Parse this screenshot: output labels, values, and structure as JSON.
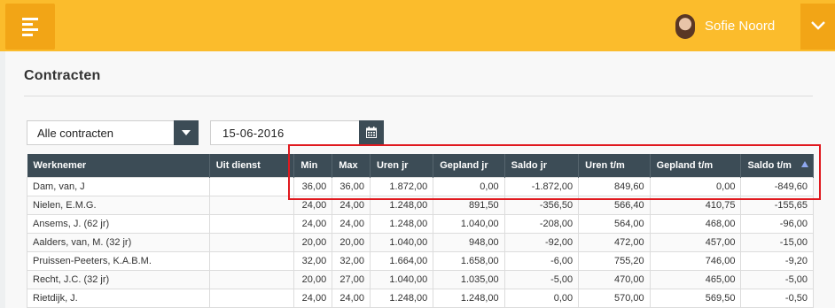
{
  "header": {
    "user_name": "Sofie Noord",
    "accent_color": "#fbbc2c",
    "accent_dark": "#f2a516",
    "menu_icon": "hamburger-menu-icon",
    "toggle_icon": "chevron-down-icon"
  },
  "page": {
    "title": "Contracten"
  },
  "filters": {
    "contract_select": "Alle contracten",
    "date": "15-06-2016",
    "date_icon": "calendar-icon",
    "select_icon": "caret-down-icon"
  },
  "table": {
    "headers": [
      "Werknemer",
      "Uit dienst",
      "Min",
      "Max",
      "Uren jr",
      "Gepland jr",
      "Saldo jr",
      "Uren t/m",
      "Gepland t/m",
      "Saldo t/m"
    ],
    "sort_column": "Saldo t/m",
    "sort_direction": "ascending",
    "rows": [
      [
        "Dam, van, J",
        "",
        "36,00",
        "36,00",
        "1.872,00",
        "0,00",
        "-1.872,00",
        "849,60",
        "0,00",
        "-849,60"
      ],
      [
        "Nielen, E.M.G.",
        "",
        "24,00",
        "24,00",
        "1.248,00",
        "891,50",
        "-356,50",
        "566,40",
        "410,75",
        "-155,65"
      ],
      [
        "Ansems, J. (62 jr)",
        "",
        "24,00",
        "24,00",
        "1.248,00",
        "1.040,00",
        "-208,00",
        "564,00",
        "468,00",
        "-96,00"
      ],
      [
        "Aalders, van, M. (32 jr)",
        "",
        "20,00",
        "20,00",
        "1.040,00",
        "948,00",
        "-92,00",
        "472,00",
        "457,00",
        "-15,00"
      ],
      [
        "Pruissen-Peeters, K.A.B.M.",
        "",
        "32,00",
        "32,00",
        "1.664,00",
        "1.658,00",
        "-6,00",
        "755,20",
        "746,00",
        "-9,20"
      ],
      [
        "Recht, J.C. (32 jr)",
        "",
        "20,00",
        "27,00",
        "1.040,00",
        "1.035,00",
        "-5,00",
        "470,00",
        "465,00",
        "-5,00"
      ],
      [
        "Rietdijk, J.",
        "",
        "24,00",
        "24,00",
        "1.248,00",
        "1.248,00",
        "0,00",
        "570,00",
        "569,50",
        "-0,50"
      ]
    ]
  }
}
